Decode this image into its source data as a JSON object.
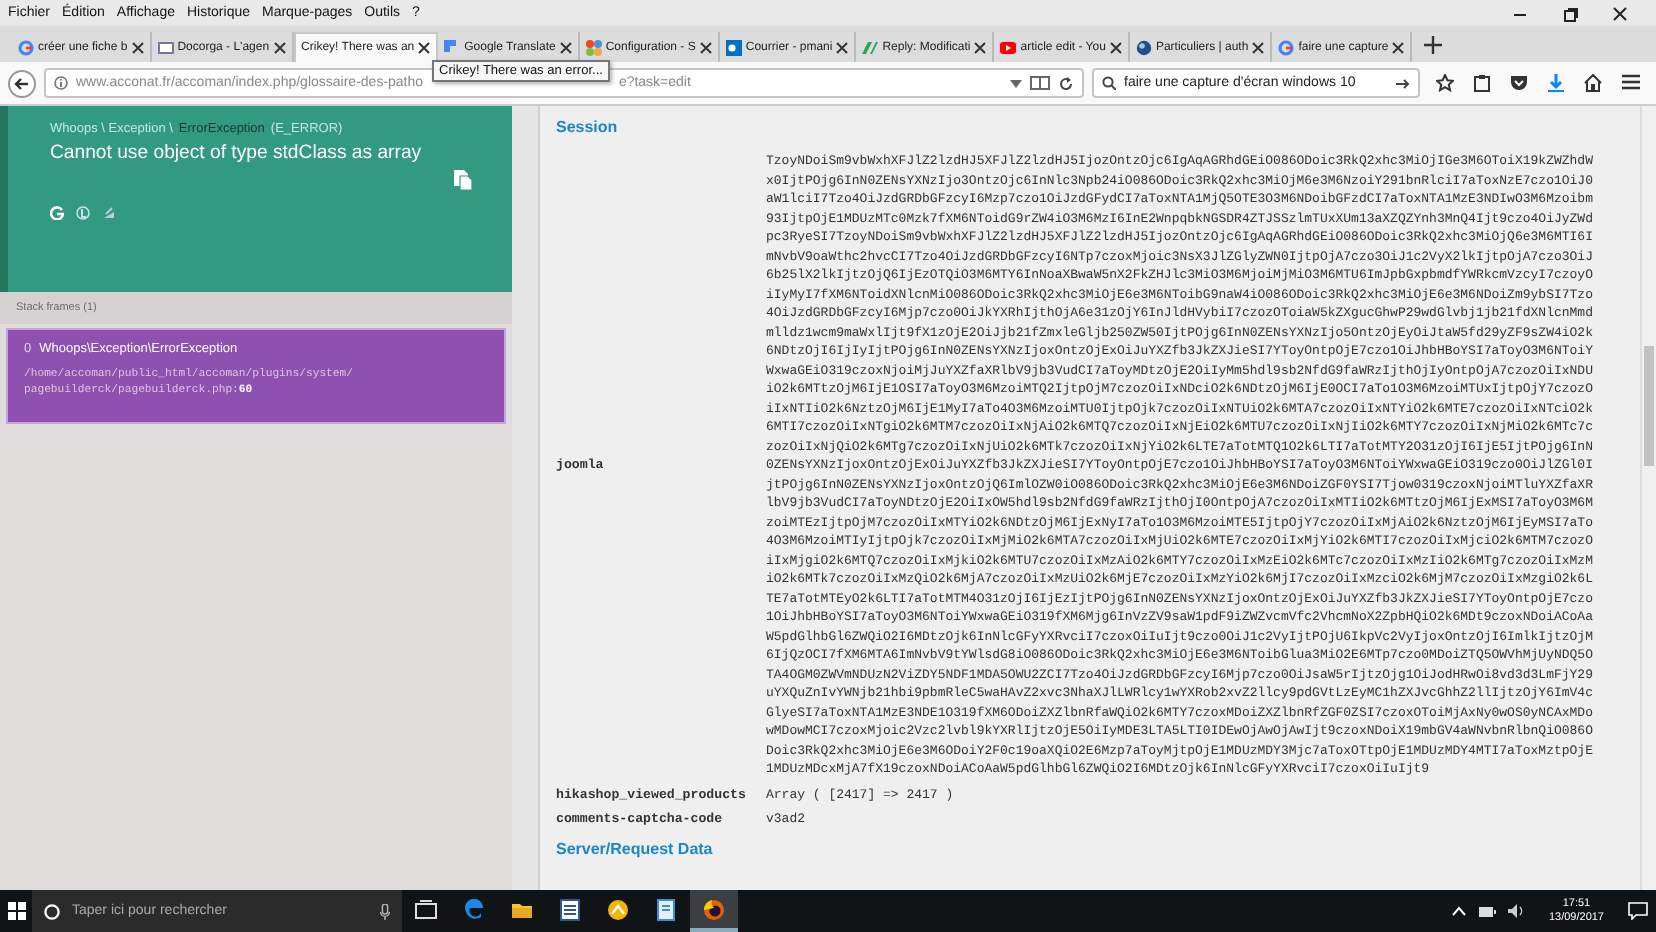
{
  "menu_bar": {
    "items": [
      "Fichier",
      "Édition",
      "Affichage",
      "Historique",
      "Marque-pages",
      "Outils",
      "?"
    ]
  },
  "tabs": [
    {
      "title": "créer une fiche b",
      "kind": "google",
      "selected": false
    },
    {
      "title": "Docorga - L'agen",
      "kind": "page",
      "selected": false
    },
    {
      "title": "Crikey! There was an",
      "kind": "none",
      "selected": true
    },
    {
      "title": "Google Translate",
      "kind": "translate",
      "selected": false
    },
    {
      "title": "Configuration - S",
      "kind": "joomla",
      "selected": false
    },
    {
      "title": "Courrier - pmani",
      "kind": "outlook",
      "selected": false
    },
    {
      "title": "Reply: Modificati",
      "kind": "reply",
      "selected": false
    },
    {
      "title": "article edit - You",
      "kind": "video",
      "selected": false
    },
    {
      "title": "Particuliers | auth",
      "kind": "globe",
      "selected": false
    },
    {
      "title": "faire une capture",
      "kind": "google",
      "selected": false
    }
  ],
  "address_bar": {
    "url_start": "www.acconat.fr/accoman/index.php/glossaire-des-patho",
    "url_end": "e?task=edit",
    "tooltip": "Crikey! There was an error..."
  },
  "search": {
    "value": "faire une capture d'écran windows 10"
  },
  "error": {
    "namespace": "Whoops \\ Exception \\",
    "class": "ErrorException",
    "code": "(E_ERROR)",
    "message": "Cannot use object of type stdClass as array"
  },
  "stack": {
    "title": "Stack frames (1)",
    "frames": [
      {
        "number": "0",
        "class": "Whoops\\Exception\\ErrorException",
        "file": "/home/accoman/public_html/accoman/plugins/system/ pagebuilderck/pagebuilderck.php:**60**",
        "selected": true
      }
    ]
  },
  "session": {
    "title": "Session",
    "rows": [
      {
        "key": "joomla",
        "value": "TzoyNDoiSm9vbWxhXFJlZ2lzdHJ5XFJlZ2lzdHJ5IjozOntzOjc6IgAqAGRhdGEiO086ODoic3RkQ2xhc3MiOjIGe3M6OToiX19kZWZhdWx0IjtPOjg6InN0ZENsYXNzIjo3OntzOjc6InNlc3Npb24iO086ODoic3RkQ2xhc3MiOjM6e3M6NzoiY291bnRlciI7aToxNzE7czo1OiJ0aW1lciI7Tzo4OiJzdGRDbGFzcyI6Mzp7czo1OiJzdGFydCI7aToxNTA1MjQ5OTE3O3M6NDoibGFzdCI7aToxNTA1MzE3NDIwO3M6Mzoibm93IjtpOjE1MDUzMTc0Mzk7fXM6NToidG9rZW4iO3M6MzI6InE2WnpqbkNGSDR4ZTJSSzlmTUxXUm13aXZQZYnh3MnQ4Ijt9czo4OiJyZWdpc3RyeSI7TzoyNDoiSm9vbWxhXFJlZ2lzdHJ5XFJlZ2lzdHJ5IjozOntzOjc6IgAqAGRhdGEiO086ODoic3RkQ2xhc3MiOjQ6e3M6MTI6ImNvbV9oaWthc2hvcCI7Tzo4OiJzdGRDbGFzcyI6NTp7czoxMjoic3NsX3JlZGlyZWN0IjtpOjA7czo3OiJ1c2VyX2lkIjtpOjA7czo3OiJ6b25lX2lkIjtzOjQ6IjEzOTQiO3M6MTY6InNoaXBwaW5nX2FkZHJlc3MiO3M6MjoiMjMiO3M6MTU6ImJpbGxpbmdfYWRkcmVzcyI7czoyOiIyMyI7fXM6NToidXNlcnMiO086ODoic3RkQ2xhc3MiOjE6e3M6NToibG9naW4iO086ODoic3RkQ2xhc3MiOjE6e3M6NDoiZm9ybSI7Tzo4OiJzdGRDbGFzcyI6Mjp7czo0OiJkYXRhIjthOjA6e31zOjY6InJldHVybiI7czozOToiaW5kZXgucGhwP29wdGlvbj1jb21fdXNlcnMmdmlldz1wcm9maWxlIjt9fX1zOjE2OiJjb21fZmxleGljb250ZW50IjtPOjg6InN0ZENsYXNzIjo5OntzOjEyOiJtaW5fd29yZF9sZW4iO2k6NDtzOjI6IjIyIjtPOjg6InN0ZENsYXNzIjoxOntzOjExOiJuYXZfb3JkZXJieSI7YToyOntpOjE7czo1OiJhbHBoYSI7aToyO3M6NToiYWxwaGEiO319czoxNjoiMjJuYXZfaXRlbV9jb3VudCI7aToyMDtzOjE2OiIyMm5hdl9sb2NfdG9faWRzIjthOjIyOntpOjA7czozOiIxNDUiO2k6MTtzOjM6IjE1OSI7aToyO3M6MzoiMTQ2IjtpOjM7czozOiIxNDciO2k6NDtzOjM6IjE0OCI7aTo1O3M6MzoiMTUxIjtpOjY7czozOiIxNTIiO2k6NztzOjM6IjE1MyI7aTo4O3M6MzoiMTU0IjtpOjk7czozOiIxNTUiO2k6MTA7czozOiIxNTYiO2k6MTE7czozOiIxNTciO2k6MTI7czozOiIxNTgiO2k6MTM7czozOiIxNjAiO2k6MTQ7czozOiIxNjEiO2k6MTU7czozOiIxNjIiO2k6MTY7czozOiIxNjMiO2k6MTc7czozOiIxNjQiO2k6MTg7czozOiIxNjUiO2k6MTk7czozOiIxNjYiO2k6LTE7aTotMTQ1O2k6LTI7aTotMTY2O31zOjI6IjE5IjtPOjg6InN0ZENsYXNzIjoxOntzOjExOiJuYXZfb3JkZXJieSI7YToyOntpOjE7czo1OiJhbHBoYSI7aToyO3M6NToiYWxwaGEiO319czo0OiJlZGl0IjtPOjg6InN0ZENsYXNzIjoxOntzOjQ6ImlOZW0iO086ODoic3RkQ2xhc3MiOjE6e3M6NDoiZGF0YSI7Tjow0319czoxNjoiMTluYXZfaXRlbV9jb3VudCI7aToyNDtzOjE2OiIxOW5hdl9sb2NfdG9faWRzIjthOjI0OntpOjA7czozOiIxMTIiO2k6MTtzOjM6IjExMSI7aToyO3M6MzoiMTEzIjtpOjM7czozOiIxMTYiO2k6NDtzOjM6IjExNyI7aTo1O3M6MzoiMTE5IjtpOjY7czozOiIxMjAiO2k6NztzOjM6IjEyMSI7aTo4O3M6MzoiMTIyIjtpOjk7czozOiIxMjMiO2k6MTA7czozOiIxMjUiO2k6MTE7czozOiIxMjYiO2k6MTI7czozOiIxMjciO2k6MTM7czozOiIxMjgiO2k6MTQ7czozOiIxMjkiO2k6MTU7czozOiIxMzAiO2k6MTY7czozOiIxMzEiO2k6MTc7czozOiIxMzIiO2k6MTg7czozOiIxMzMiO2k6MTk7czozOiIxMzQiO2k6MjA7czozOiIxMzUiO2k6MjE7czozOiIxMzYiO2k6MjI7czozOiIxMzciO2k6MjM7czozOiIxMzgiO2k6LTE7aTotMTEyO2k6LTI7aTotMTM4O31zOjI6IjEzIjtPOjg6InN0ZENsYXNzIjoxOntzOjExOiJuYXZfb3JkZXJieSI7YToyOntpOjE7czo1OiJhbHBoYSI7aToyO3M6NToiYWxwaGEiO319fXM6Mjg6InVzZV9saW1pdF9iZWZvcmVfc2VhcmNoX2ZpbHQiO2k6MDt9czoxNDoiACoAaW5pdGlhbGl6ZWQiO2I6MDtzOjk6InNlcGFyYXRvciI7czoxOiIuIjt9czo0OiJ1c2VyIjtPOjU6IkpVc2VyIjoxOntzOjI6ImlkIjtzOjM6IjQzOCI7fXM6MTA6ImNvbV9tYWlsdG8iO086ODoic3RkQ2xhc3MiOjE6e3M6NToibGlua3MiO2E6MTp7czo0MDoiZTQ5OWVhMjUyNDQ5OTA4OGM0ZWVmNDUzN2ViZDY5NDF1MDA5OWU2ZCI7Tzo4OiJzdGRDbGFzcyI6Mjp7czo0OiJsaW5rIjtzOjg1OiJodHRwOi8vd3d3LmFjY29uYXQuZnIvYWNjb21hbi9pbmRleC5waHAvZ2xvc3NhaXJlLWRlcy1wYXRob2xvZ2llcy9pdGVtLzEyMC1hZXJvcGhhZ2llIjtzOjY6ImV4cGlyeSI7aToxNTA1MzE3NDE1O319fXM6ODoiZXZlbnRfaWQiO2k6MTY7czoxMDoiZXZlbnRfZGF0ZSI7czoxOToiMjAxNy0wOS0yNCAxMDowMDowMCI7czoxMjoic2Vzc2lvbl9kYXRlIjtzOjE5OiIyMDE3LTA5LTI0IDEwOjAwOjAwIjt9czoxNDoiX19mbGV4aWNvbnRlbnQiO086ODoic3RkQ2xhc3MiOjE6e3M6ODoiY2F0c19oaXQiO2E6Mzp7aToyMjtpOjE1MDUzMDY3Mjc7aToxOTtpOjE1MDUzMDY4MTI7aToxMztpOjE1MDUzMDcxMjA7fX19czoxNDoiACoAaW5pdGlhbGl6ZWQiO2I6MDtzOjk6InNlcGFyYXRvciI7czoxOiIuIjt9"
      },
      {
        "key": "hikashop_viewed_products",
        "value": "Array ( [2417] => 2417 )"
      },
      {
        "key": "comments-captcha-code",
        "value": "v3ad2"
      }
    ]
  },
  "next_section": {
    "title": "Server/Request Data"
  },
  "taskbar": {
    "search_placeholder": "Taper ici pour rechercher",
    "apps": [
      {
        "kind": "task-view",
        "selected": false
      },
      {
        "kind": "edge",
        "selected": false
      },
      {
        "kind": "folder",
        "selected": false
      },
      {
        "kind": "doc",
        "selected": false
      },
      {
        "kind": "yellow",
        "selected": false
      },
      {
        "kind": "notes",
        "selected": false
      },
      {
        "kind": "firefox",
        "selected": true
      }
    ],
    "time": "17:51",
    "date": "13/09/2017"
  }
}
